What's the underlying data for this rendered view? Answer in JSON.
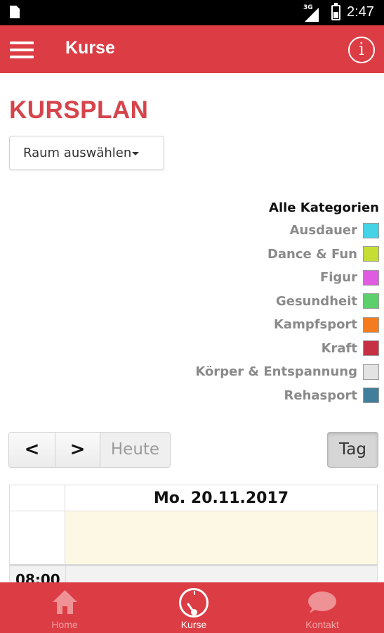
{
  "status_bar": {
    "network": "3G",
    "time": "2:47"
  },
  "app_bar": {
    "title": "Kurse",
    "info_icon": "info-icon",
    "info_glyph": "i",
    "menu_icon": "hamburger-menu-icon"
  },
  "page": {
    "title": "KURSPLAN",
    "room_select": {
      "label": "Raum auswählen"
    }
  },
  "legend": {
    "heading": "Alle Kategorien",
    "items": [
      {
        "label": "Ausdauer",
        "color": "#45d4e7"
      },
      {
        "label": "Dance & Fun",
        "color": "#c6dd36"
      },
      {
        "label": "Figur",
        "color": "#e05be2"
      },
      {
        "label": "Gesundheit",
        "color": "#5cd06a"
      },
      {
        "label": "Kampfsport",
        "color": "#f57c1c"
      },
      {
        "label": "Kraft",
        "color": "#c72f45"
      },
      {
        "label": "Körper & Entspannung",
        "color": "#e3e3e3"
      },
      {
        "label": "Rehasport",
        "color": "#3f7f9a"
      }
    ]
  },
  "calendar_nav": {
    "prev_label": "<",
    "next_label": ">",
    "today_label": "Heute",
    "view_label": "Tag"
  },
  "calendar": {
    "date_header": "Mo. 20.11.2017",
    "first_time": "08:00"
  },
  "bottom_nav": {
    "items": [
      {
        "label": "Home",
        "icon": "home-icon",
        "active": false
      },
      {
        "label": "Kurse",
        "icon": "speedometer-icon",
        "active": true
      },
      {
        "label": "Kontakt",
        "icon": "chat-bubble-icon",
        "active": false
      }
    ]
  },
  "colors": {
    "primary": "#dc3c43",
    "title_red": "#d6444c",
    "allday_bg": "#fcf8e3"
  }
}
